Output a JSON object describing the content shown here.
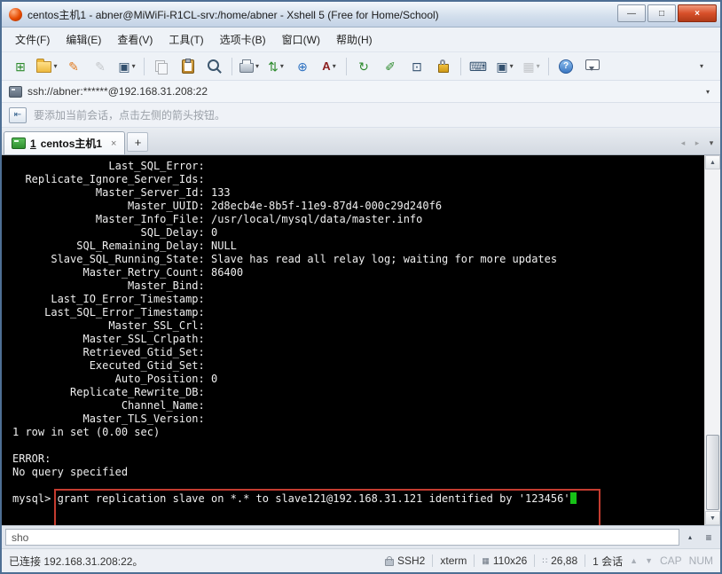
{
  "window": {
    "title": "centos主机1 - abner@MiWiFi-R1CL-srv:/home/abner - Xshell 5 (Free for Home/School)"
  },
  "icons": {
    "minimize": "—",
    "maximize": "□",
    "close": "×",
    "chevron_down": "▾",
    "chevron_up": "▴",
    "new_session": "⊞",
    "crayon": "✎",
    "pencil": "✎",
    "terminal": "▣",
    "transfer": "⇅",
    "globe": "⊕",
    "font": "A",
    "reconnect": "↻",
    "compose": "✐",
    "fullscreen": "⊡",
    "keyboard": "⌨",
    "new_window": "▣",
    "tile": "▦",
    "help": "?",
    "hamburger": "≡",
    "scroll_up": "▲",
    "scroll_down": "▼",
    "nav_left": "◂",
    "nav_right": "▸",
    "add_arrow": "⇤",
    "size_grid": "▦",
    "position": "∷"
  },
  "menu_bar": {
    "items": [
      "文件(F)",
      "编辑(E)",
      "查看(V)",
      "工具(T)",
      "选项卡(B)",
      "窗口(W)",
      "帮助(H)"
    ]
  },
  "address_bar": {
    "value": "ssh://abner:******@192.168.31.208:22"
  },
  "info_bar": {
    "message": "要添加当前会话，点击左侧的箭头按钮。"
  },
  "tab_bar": {
    "active_tab": {
      "index": "1",
      "name": "centos主机1"
    },
    "new_tab": "+"
  },
  "terminal": {
    "output": "               Last_SQL_Error: \n  Replicate_Ignore_Server_Ids: \n             Master_Server_Id: 133\n                  Master_UUID: 2d8ecb4e-8b5f-11e9-87d4-000c29d240f6\n             Master_Info_File: /usr/local/mysql/data/master.info\n                    SQL_Delay: 0\n          SQL_Remaining_Delay: NULL\n      Slave_SQL_Running_State: Slave has read all relay log; waiting for more updates\n           Master_Retry_Count: 86400\n                  Master_Bind: \n      Last_IO_Error_Timestamp: \n     Last_SQL_Error_Timestamp: \n               Master_SSL_Crl: \n           Master_SSL_Crlpath: \n           Retrieved_Gtid_Set: \n            Executed_Gtid_Set: \n                Auto_Position: 0\n         Replicate_Rewrite_DB: \n                 Channel_Name: \n           Master_TLS_Version: \n1 row in set (0.00 sec)\n\nERROR: \nNo query specified",
    "prompt": "mysql> ",
    "command": "grant replication slave on *.* to slave121@192.168.31.121 identified by '123456'"
  },
  "quick_command": {
    "value": "sho"
  },
  "status_bar": {
    "connection": "已连接 192.168.31.208:22。",
    "protocol": "SSH2",
    "terminal_type": "xterm",
    "terminal_size": "110x26",
    "cursor_position": "26,88",
    "session_count": "1 会话",
    "caps_indicator": "CAP",
    "num_indicator": "NUM"
  },
  "colors": {
    "annotation_red": "#c43c30",
    "cursor_green": "#17c117",
    "terminal_bg": "#000000",
    "terminal_fg": "#efefef",
    "tab_icon_green": "#2f8f2f"
  }
}
